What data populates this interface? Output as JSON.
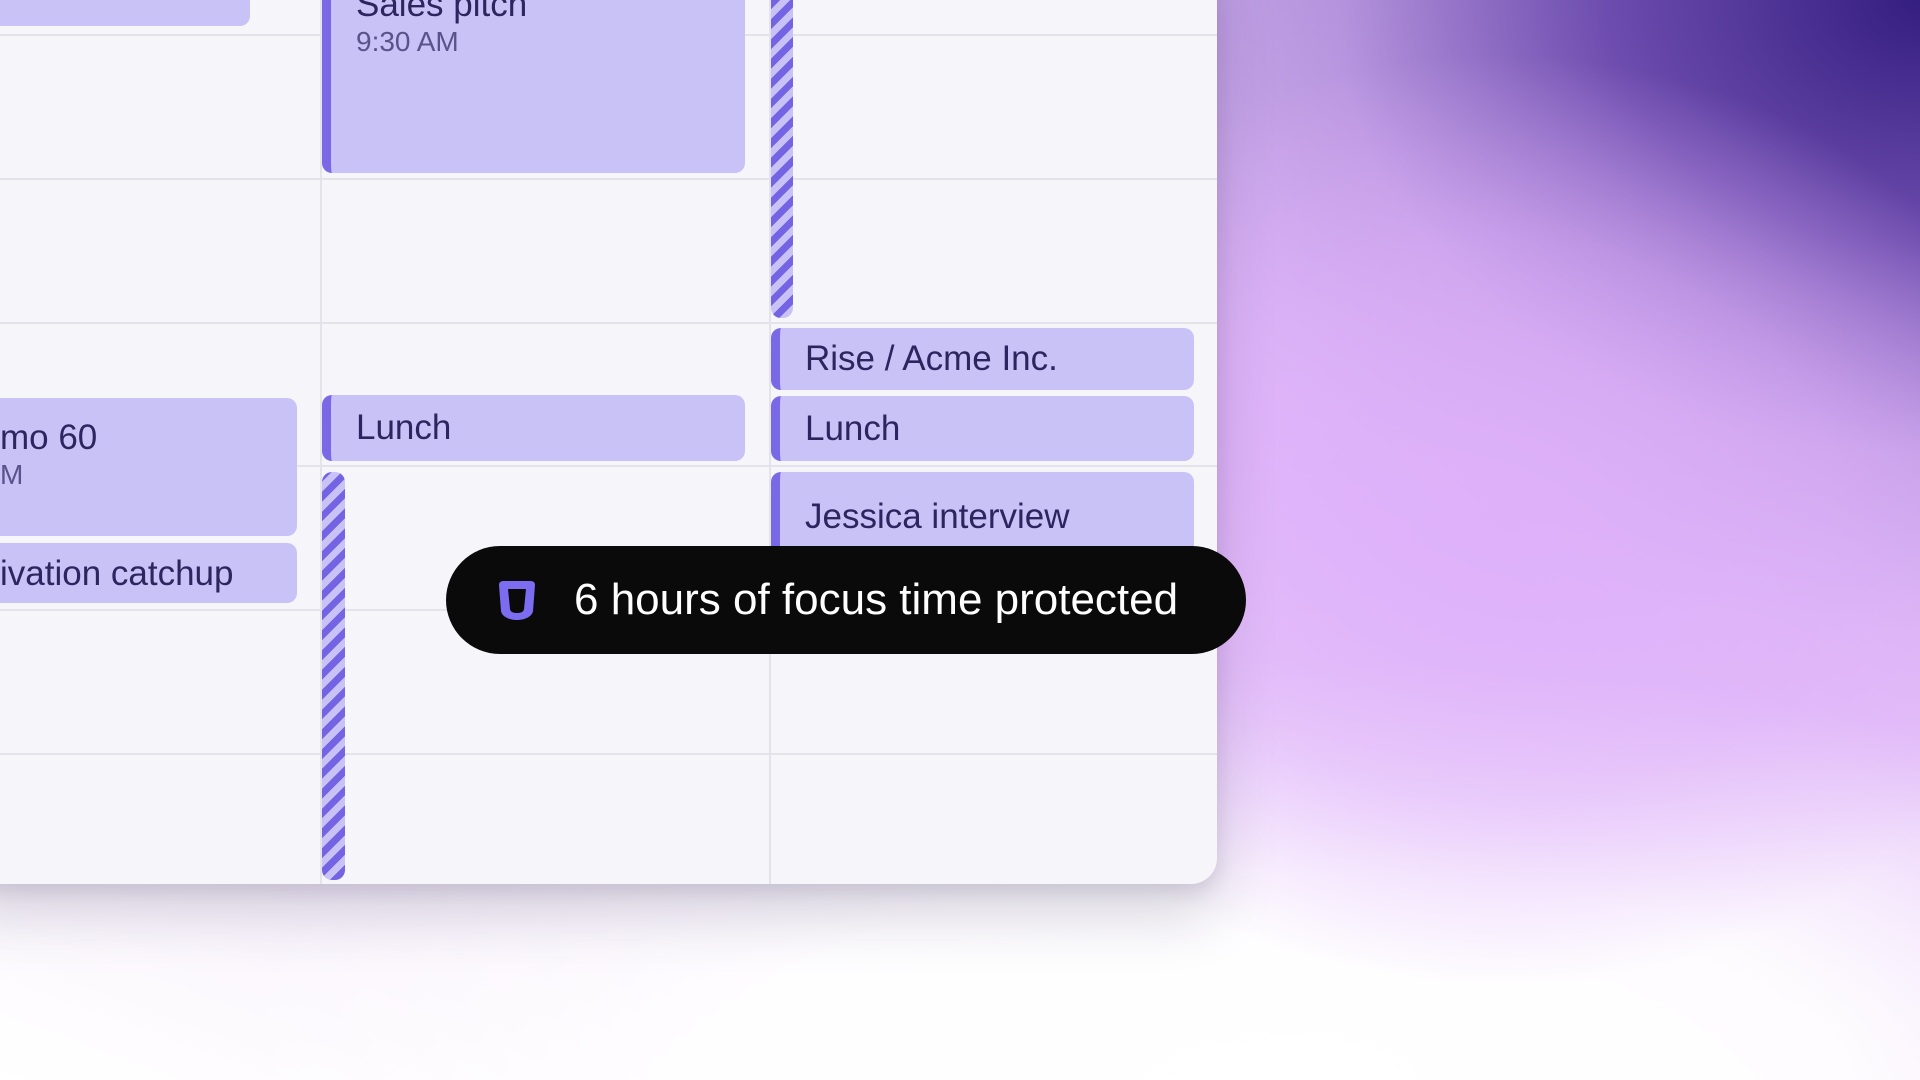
{
  "calendar": {
    "events": {
      "sales_pitch": {
        "title": "Sales pitch",
        "time": "9:30 AM"
      },
      "demo": {
        "title": "mo 60",
        "time": "M"
      },
      "activation": {
        "title": "ivation catchup"
      },
      "lunch_1": {
        "title": "Lunch"
      },
      "rise_acme": {
        "title": "Rise / Acme Inc."
      },
      "lunch_2": {
        "title": "Lunch"
      },
      "jessica": {
        "title": "Jessica interview"
      }
    }
  },
  "toast": {
    "message": "6 hours of focus time protected",
    "icon": "shield-icon"
  },
  "colors": {
    "event_fill": "#c9c2f6",
    "event_accent": "#7a69e6",
    "toast_bg": "#0a0a0b",
    "icon_accent": "#7b6cf0"
  }
}
